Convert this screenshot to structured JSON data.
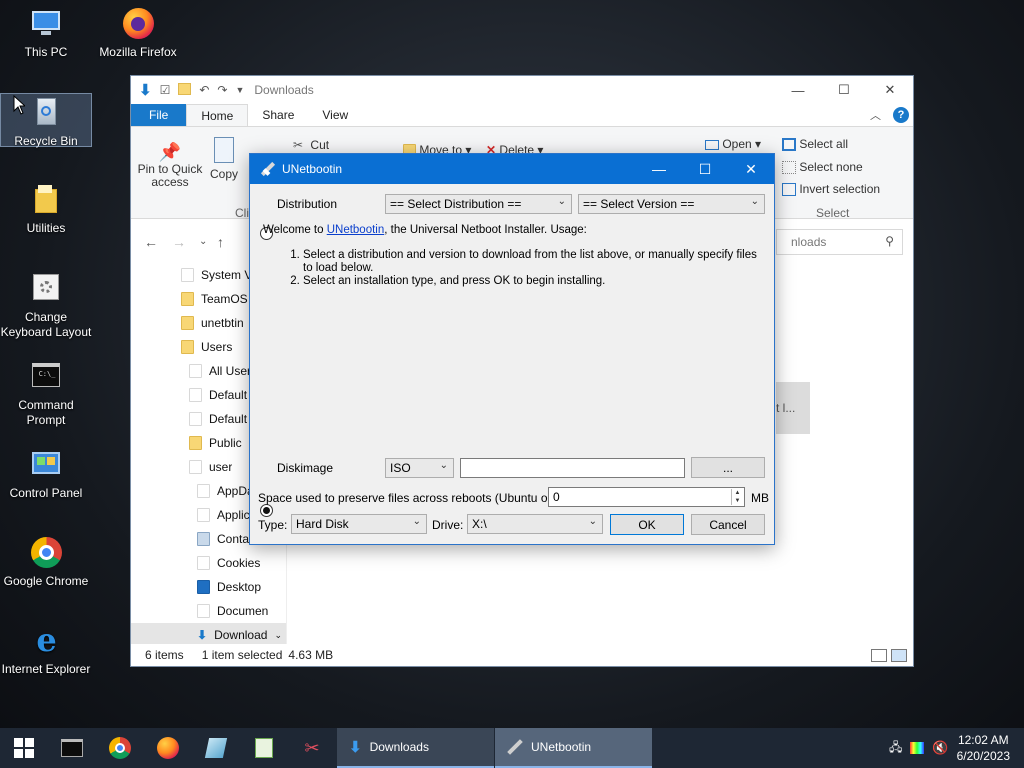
{
  "desktop": {
    "icons": [
      {
        "label": "This PC",
        "icon": "computer-icon"
      },
      {
        "label": "Mozilla Firefox",
        "icon": "firefox-icon"
      },
      {
        "label": "Recycle Bin",
        "icon": "recycle-bin-icon"
      },
      {
        "label": "Utilities",
        "icon": "folder-icon"
      },
      {
        "label": "Change Keyboard Layout",
        "icon": "keyboard-icon"
      },
      {
        "label": "Command Prompt",
        "icon": "terminal-icon"
      },
      {
        "label": "Control Panel",
        "icon": "control-panel-icon"
      },
      {
        "label": "Google Chrome",
        "icon": "chrome-icon"
      },
      {
        "label": "Internet Explorer",
        "icon": "ie-icon"
      }
    ]
  },
  "explorer": {
    "title": "Downloads",
    "tabs": {
      "file": "File",
      "home": "Home",
      "share": "Share",
      "view": "View"
    },
    "ribbon": {
      "pin": "Pin to Quick access",
      "copy": "Copy",
      "cut": "Cut",
      "clipboard": "Cli",
      "move_to": "Move to",
      "delete": "Delete",
      "open": "Open",
      "select_all": "Select all",
      "select_none": "Select none",
      "invert_selection": "Invert selection",
      "select_group": "Select"
    },
    "search_placeholder": "nloads",
    "tree": [
      "System Vo",
      "TeamOS",
      "unetbtin",
      "Users",
      "All Users",
      "Default",
      "Default",
      "Public",
      "user",
      "AppDa",
      "Applic",
      "Conta",
      "Cookies",
      "Desktop",
      "Documen",
      "Download"
    ],
    "hint_text": "t l...",
    "status": {
      "items": "6 items",
      "selected": "1 item selected",
      "size": "4.63 MB"
    }
  },
  "unetbootin": {
    "title": "UNetbootin",
    "distribution_label": "Distribution",
    "select_distribution": "== Select Distribution ==",
    "select_version": "== Select Version ==",
    "welcome_prefix": "Welcome to ",
    "welcome_link": "UNetbootin",
    "welcome_suffix": ", the Universal Netboot Installer. Usage:",
    "steps": [
      "Select a distribution and version to download from the list above, or manually specify files to load below.",
      "Select an installation type, and press OK to begin installing."
    ],
    "diskimage_label": "Diskimage",
    "diskimage_type": "ISO",
    "diskimage_path": "",
    "browse_label": "...",
    "persist_label": "Space used to preserve files across reboots (Ubuntu only):",
    "persist_value": "0",
    "persist_unit": "MB",
    "type_label": "Type:",
    "type_value": "Hard Disk",
    "drive_label": "Drive:",
    "drive_value": "X:\\",
    "ok_label": "OK",
    "cancel_label": "Cancel"
  },
  "taskbar": {
    "tasks": [
      {
        "label": "Downloads",
        "icon": "downloads-icon"
      },
      {
        "label": "UNetbootin",
        "icon": "unetbootin-icon"
      }
    ],
    "time": "12:02 AM",
    "date": "6/20/2023"
  }
}
